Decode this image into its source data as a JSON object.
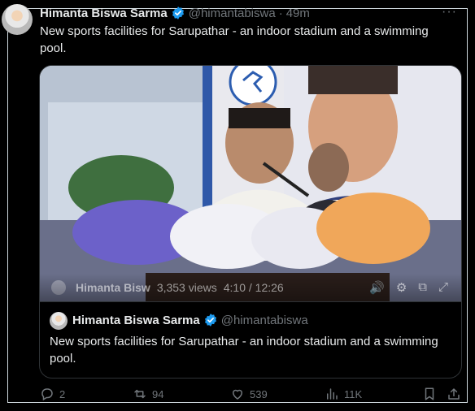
{
  "tweet": {
    "author_name": "Himanta Biswa Sarma",
    "handle": "@himantabiswa",
    "separator": "·",
    "time": "49m",
    "more_label": "···",
    "text": "New sports facilities for Sarupathar - an indoor stadium and a swimming pool."
  },
  "video": {
    "overlay_author": "Himanta Bisw",
    "views": "3,353 views",
    "progress": "4:10 / 12:26",
    "current_seconds": 250,
    "duration_seconds": 746
  },
  "quoted_tweet": {
    "author_name": "Himanta Biswa Sarma",
    "handle": "@himantabiswa",
    "text": "New sports facilities for Sarupathar - an indoor stadium and a swimming pool."
  },
  "actions": {
    "replies": "2",
    "reposts": "94",
    "likes": "539",
    "views": "11K"
  },
  "colors": {
    "background": "#000000",
    "text": "#e7e9ea",
    "muted": "#71767b",
    "verified": "#1d9bf0",
    "border": "#2f3336"
  }
}
